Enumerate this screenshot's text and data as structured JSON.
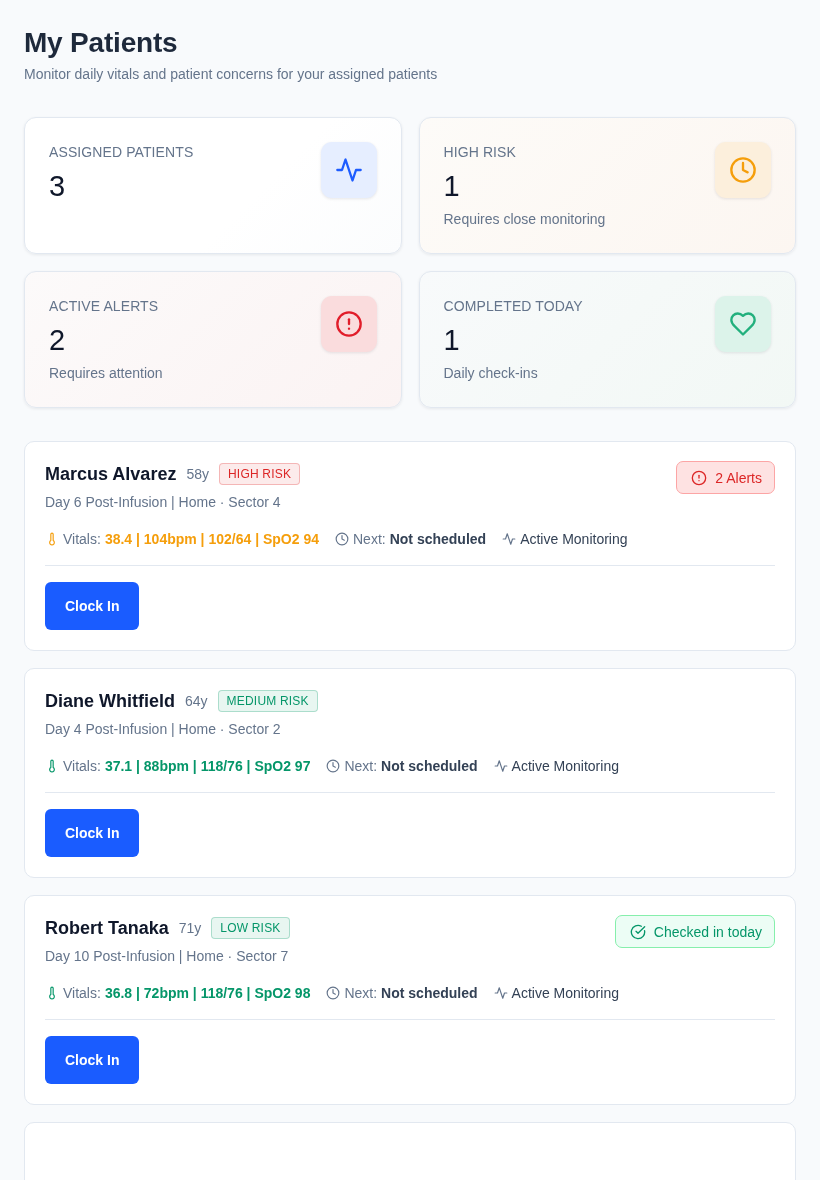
{
  "page": {
    "title": "My Patients",
    "subtitle": "Monitor daily vitals and patient concerns for your assigned patients"
  },
  "stats": [
    {
      "kind": "pulse",
      "label": "ASSIGNED PATIENTS",
      "value": "3"
    },
    {
      "kind": "clock",
      "label": "HIGH RISK",
      "value": "1",
      "note": "Requires close monitoring"
    },
    {
      "kind": "alert",
      "label": "ACTIVE ALERTS",
      "value": "2",
      "note": "Requires attention"
    },
    {
      "kind": "heart",
      "label": "COMPLETED TODAY",
      "value": "1",
      "note": "Daily check-ins"
    }
  ],
  "patients": [
    {
      "name": "Marcus Alvarez",
      "age": "58y",
      "risk": {
        "label": "HIGH RISK",
        "color": "#dc2626"
      },
      "status": {
        "kind": "alerts",
        "label": "2 Alerts"
      },
      "details": "Day 6 Post-Infusion | Home · Sector 4",
      "vitals_label": "Vitals:",
      "vitals": {
        "value": "38.4 | 104bpm | 102/64 | SpO2 94",
        "color": "#f59e0b"
      },
      "next_label": "Next:",
      "next": "Not scheduled",
      "monitoring": "Active Monitoring",
      "button": "Clock In"
    },
    {
      "name": "Diane Whitfield",
      "age": "64y",
      "risk": {
        "label": "MEDIUM RISK",
        "color": "#059669"
      },
      "details": "Day 4 Post-Infusion | Home · Sector 2",
      "vitals_label": "Vitals:",
      "vitals": {
        "value": "37.1 | 88bpm | 118/76 | SpO2 97",
        "color": "#059669"
      },
      "next_label": "Next:",
      "next": "Not scheduled",
      "monitoring": "Active Monitoring",
      "button": "Clock In"
    },
    {
      "name": "Robert Tanaka",
      "age": "71y",
      "risk": {
        "label": "LOW RISK",
        "color": "#059669"
      },
      "status": {
        "kind": "checked",
        "label": "Checked in today"
      },
      "details": "Day 10 Post-Infusion | Home · Sector 7",
      "vitals_label": "Vitals:",
      "vitals": {
        "value": "36.8 | 72bpm | 118/76 | SpO2 98",
        "color": "#059669"
      },
      "next_label": "Next:",
      "next": "Not scheduled",
      "monitoring": "Active Monitoring",
      "button": "Clock In"
    }
  ]
}
